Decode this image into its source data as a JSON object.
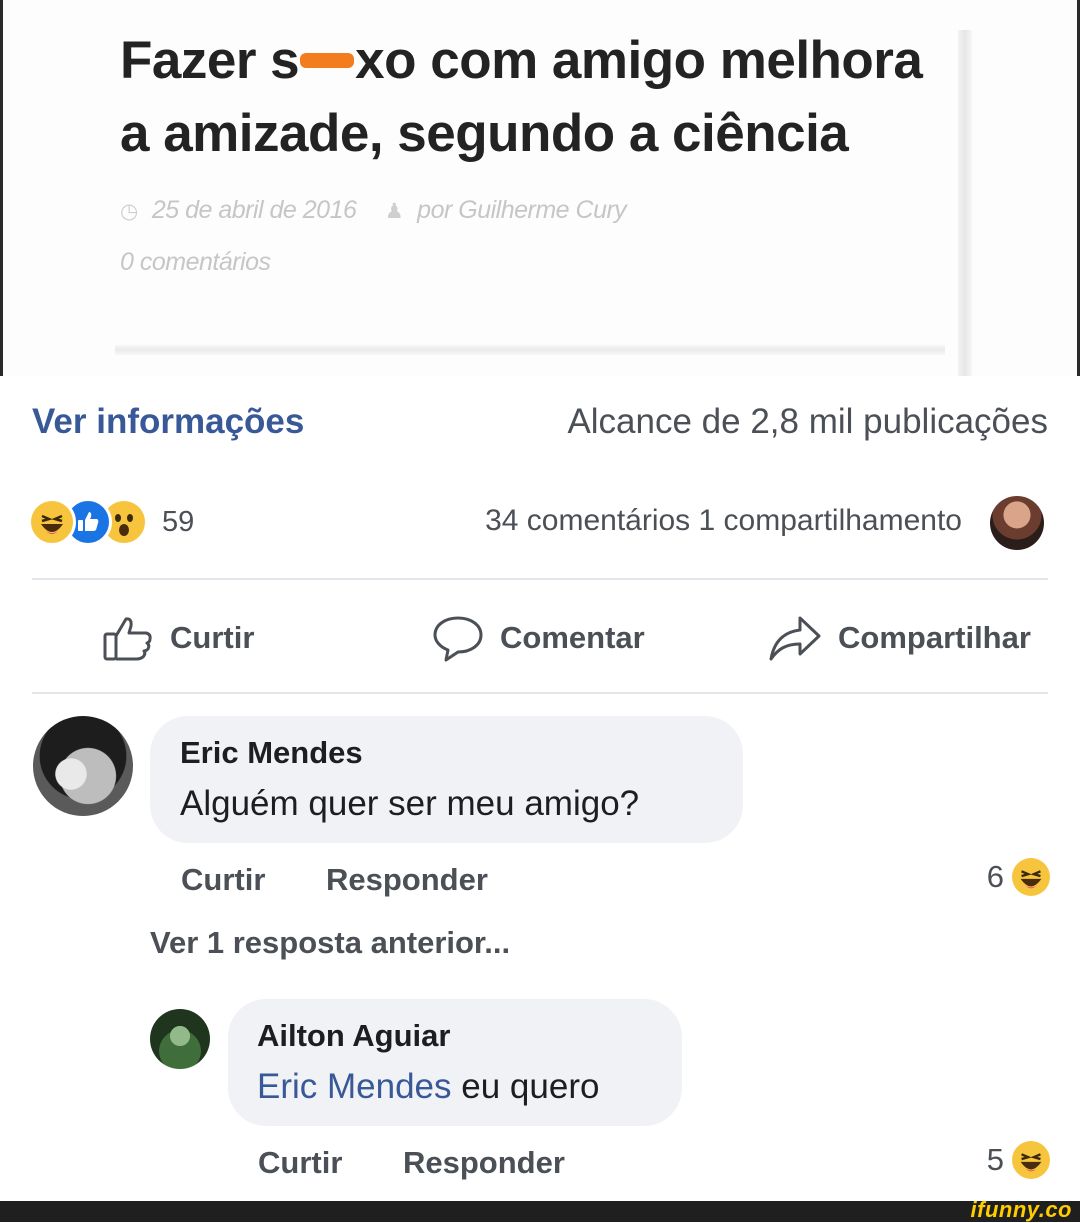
{
  "article": {
    "title_before": "Fazer s",
    "title_after": "xo com amigo melhora a amizade, segundo a ciência",
    "date": "25 de abril de 2016",
    "author": "por Guilherme Cury",
    "comments": "0 comentários"
  },
  "info": {
    "link": "Ver informações",
    "reach": "Alcance de 2,8 mil publicações"
  },
  "stats": {
    "reaction_count": "59",
    "reaction_types": [
      "haha",
      "like",
      "wow"
    ],
    "counts": "34 comentários 1 compartilhamento"
  },
  "actions": {
    "like": "Curtir",
    "comment": "Comentar",
    "share": "Compartilhar"
  },
  "comments": [
    {
      "author": "Eric Mendes",
      "text": "Alguém quer ser meu amigo?",
      "like": "Curtir",
      "reply": "Responder",
      "reactions": "6"
    }
  ],
  "previous_replies": "Ver 1 resposta anterior...",
  "replies": [
    {
      "author": "Ailton Aguiar",
      "mention": "Eric Mendes",
      "text": "eu quero",
      "like": "Curtir",
      "reply": "Responder",
      "reactions": "5"
    }
  ],
  "watermark": "ifunny.co",
  "colors": {
    "link_blue": "#385898",
    "like_blue": "#1b74e4",
    "haha_yellow": "#f7c53d",
    "censor_orange": "#f27c1e",
    "bubble_gray": "#f0f2f5"
  }
}
